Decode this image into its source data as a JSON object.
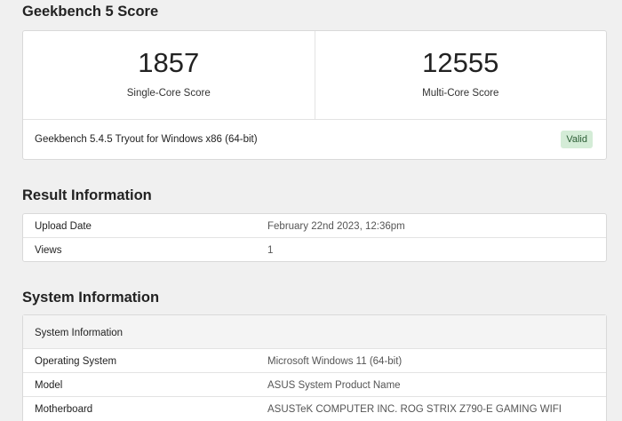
{
  "score": {
    "title": "Geekbench 5 Score",
    "single_core_value": "1857",
    "single_core_label": "Single-Core Score",
    "multi_core_value": "12555",
    "multi_core_label": "Multi-Core Score",
    "version": "Geekbench 5.4.5 Tryout for Windows x86 (64-bit)",
    "status": "Valid",
    "status_color": "#d4ecd7"
  },
  "result_info": {
    "title": "Result Information",
    "rows": [
      {
        "key": "Upload Date",
        "value": "February 22nd 2023, 12:36pm"
      },
      {
        "key": "Views",
        "value": "1"
      }
    ]
  },
  "system_info": {
    "title": "System Information",
    "header": "System Information",
    "rows": [
      {
        "key": "Operating System",
        "value": "Microsoft Windows 11 (64-bit)"
      },
      {
        "key": "Model",
        "value": "ASUS System Product Name"
      },
      {
        "key": "Motherboard",
        "value": "ASUSTeK COMPUTER INC. ROG STRIX Z790-E GAMING WIFI"
      }
    ]
  }
}
